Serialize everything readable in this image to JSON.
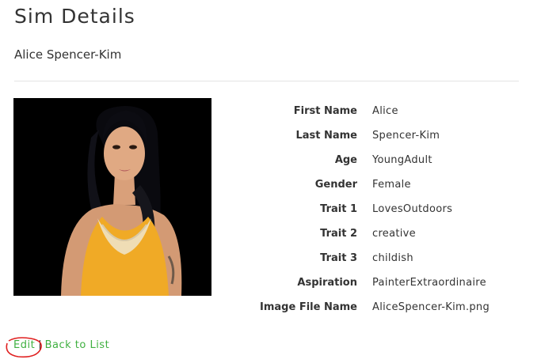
{
  "header": {
    "title": "Sim Details",
    "sim_name": "Alice Spencer-Kim"
  },
  "details": [
    {
      "label": "First Name",
      "value": "Alice"
    },
    {
      "label": "Last Name",
      "value": "Spencer-Kim"
    },
    {
      "label": "Age",
      "value": "YoungAdult"
    },
    {
      "label": "Gender",
      "value": "Female"
    },
    {
      "label": "Trait 1",
      "value": "LovesOutdoors"
    },
    {
      "label": "Trait 2",
      "value": "creative"
    },
    {
      "label": "Trait 3",
      "value": "childish"
    },
    {
      "label": "Aspiration",
      "value": "PainterExtraordinaire"
    },
    {
      "label": "Image File Name",
      "value": "AliceSpencer-Kim.png"
    }
  ],
  "actions": {
    "edit_label": "Edit",
    "separator": "|",
    "back_label": "Back to List"
  },
  "colors": {
    "link": "#3fb040",
    "annotation": "#e02020",
    "portrait_background": "#000000"
  }
}
